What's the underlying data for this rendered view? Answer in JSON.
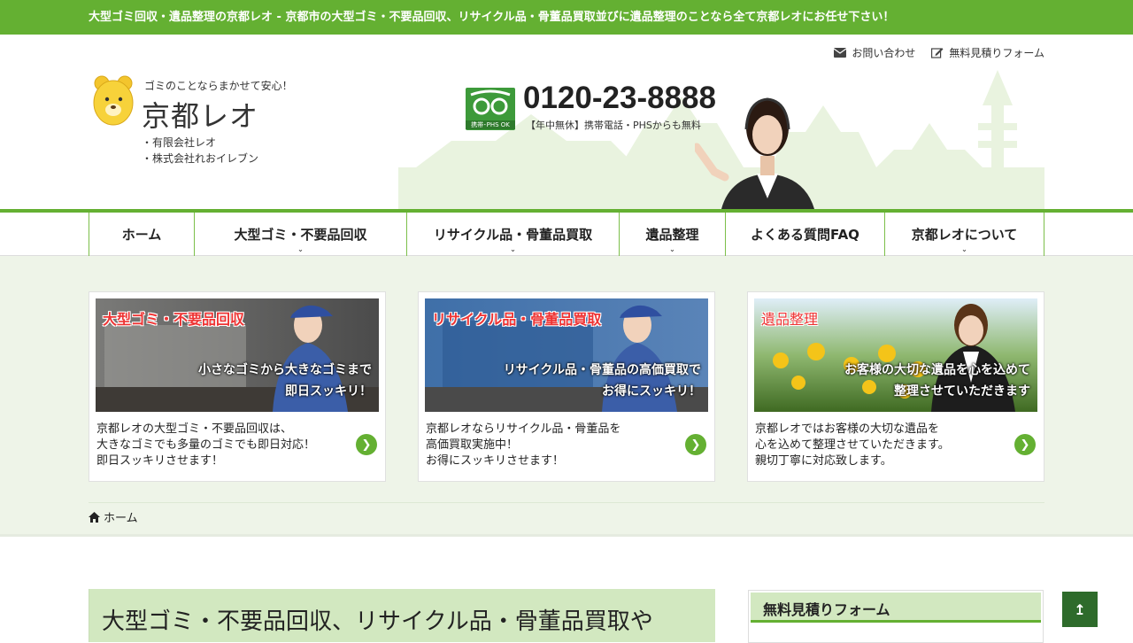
{
  "topbar": {
    "text": "大型ゴミ回収・遺品整理の京都レオ  -  京都市の大型ゴミ・不要品回収、リサイクル品・骨董品買取並びに遺品整理のことなら全て京都レオにお任せ下さい！"
  },
  "header": {
    "links": [
      {
        "label": "お問い合わせ",
        "icon": "envelope-icon"
      },
      {
        "label": "無料見積りフォーム",
        "icon": "edit-icon"
      }
    ],
    "logo": {
      "tagline": "ゴミのことならまかせて安心！",
      "name": "京都レオ",
      "companies": [
        "・有限会社レオ",
        "・株式会社れおイレブン"
      ]
    },
    "phone": {
      "badge_text": "携帯･PHS OK",
      "number": "0120-23-8888",
      "note": "【年中無休】携帯電話・PHSからも無料"
    }
  },
  "nav": {
    "items": [
      {
        "label": "ホーム",
        "has_sub": false
      },
      {
        "label": "大型ゴミ・不要品回収",
        "has_sub": true
      },
      {
        "label": "リサイクル品・骨董品買取",
        "has_sub": true
      },
      {
        "label": "遺品整理",
        "has_sub": true
      },
      {
        "label": "よくある質問FAQ",
        "has_sub": false
      },
      {
        "label": "京都レオについて",
        "has_sub": true
      }
    ]
  },
  "cards": [
    {
      "title": "大型ゴミ・不要品回収",
      "caption": [
        "小さなゴミから大きなゴミまで",
        "即日スッキリ！"
      ],
      "desc": [
        "京都レオの大型ゴミ・不要品回収は、",
        "大きなゴミでも多量のゴミでも即日対応！",
        "即日スッキリさせます！"
      ]
    },
    {
      "title": "リサイクル品・骨董品買取",
      "caption": [
        "リサイクル品・骨董品の高価買取で",
        "お得にスッキリ！"
      ],
      "desc": [
        "京都レオならリサイクル品・骨董品を",
        "高価買取実施中！",
        "お得にスッキリさせます！"
      ]
    },
    {
      "title": "遺品整理",
      "caption": [
        "お客様の大切な遺品を心を込めて",
        "整理させていただきます"
      ],
      "desc": [
        "京都レオではお客様の大切な遺品を",
        "心を込めて整理させていただきます。",
        "親切丁寧に対応致します。"
      ]
    }
  ],
  "breadcrumb": {
    "home": "ホーム"
  },
  "main": {
    "title": "大型ゴミ・不要品回収、リサイクル品・骨董品買取や"
  },
  "sidebar": {
    "widget_title": "無料見積りフォーム"
  },
  "colors": {
    "brand_green": "#64b032",
    "light_green": "#d2e8c0",
    "accent_red": "#e33"
  }
}
